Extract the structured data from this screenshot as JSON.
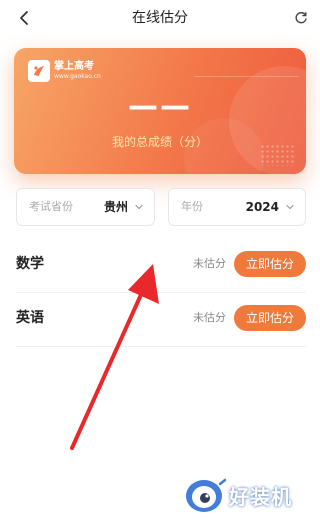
{
  "header": {
    "title": "在线估分"
  },
  "score_card": {
    "brand_name": "掌上高考",
    "brand_url": "www.gaokao.cn",
    "score_value": "——",
    "score_label": "我的总成绩（分）"
  },
  "filters": {
    "province": {
      "label": "考试省份",
      "value": "贵州"
    },
    "year": {
      "label": "年份",
      "value": "2024"
    }
  },
  "subjects": [
    {
      "name": "数学",
      "status": "未估分",
      "action": "立即估分"
    },
    {
      "name": "英语",
      "status": "未估分",
      "action": "立即估分"
    }
  ],
  "watermark": {
    "text": "好装机"
  },
  "colors": {
    "accent": "#ef7a3c",
    "card_start": "#f7a667",
    "card_end": "#ee5a3d",
    "arrow": "#e8282b"
  }
}
